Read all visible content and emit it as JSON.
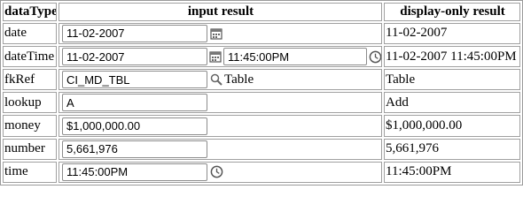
{
  "headers": [
    "dataType",
    "input result",
    "display-only result"
  ],
  "rows": [
    {
      "type": "date",
      "input1": "11-02-2007",
      "display": "11-02-2007"
    },
    {
      "type": "dateTime",
      "input1": "11-02-2007",
      "input2": "11:45:00PM",
      "display": "11-02-2007 11:45:00PM"
    },
    {
      "type": "fkRef",
      "input1": "CI_MD_TBL",
      "extra": "Table",
      "display": "Table"
    },
    {
      "type": "lookup",
      "input1": "A",
      "display": "Add"
    },
    {
      "type": "money",
      "input1": "$1,000,000.00",
      "display": "$1,000,000.00"
    },
    {
      "type": "number",
      "input1": "5,661,976",
      "display": "5,661,976"
    },
    {
      "type": "time",
      "input1": "11:45:00PM",
      "display": "11:45:00PM"
    }
  ],
  "icons": {
    "calendar": "calendar-icon",
    "clock": "clock-icon",
    "search": "search-icon"
  }
}
